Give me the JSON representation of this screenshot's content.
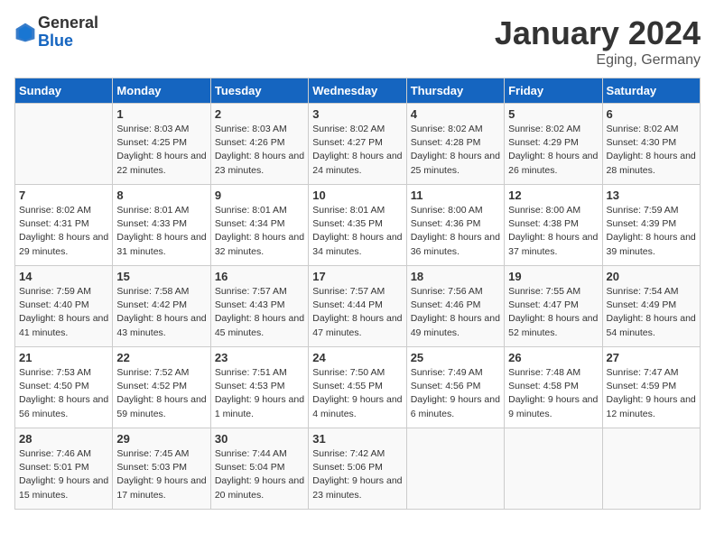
{
  "header": {
    "logo_general": "General",
    "logo_blue": "Blue",
    "title": "January 2024",
    "location": "Eging, Germany"
  },
  "days_of_week": [
    "Sunday",
    "Monday",
    "Tuesday",
    "Wednesday",
    "Thursday",
    "Friday",
    "Saturday"
  ],
  "weeks": [
    [
      {
        "day": "",
        "sunrise": "",
        "sunset": "",
        "daylight": ""
      },
      {
        "day": "1",
        "sunrise": "Sunrise: 8:03 AM",
        "sunset": "Sunset: 4:25 PM",
        "daylight": "Daylight: 8 hours and 22 minutes."
      },
      {
        "day": "2",
        "sunrise": "Sunrise: 8:03 AM",
        "sunset": "Sunset: 4:26 PM",
        "daylight": "Daylight: 8 hours and 23 minutes."
      },
      {
        "day": "3",
        "sunrise": "Sunrise: 8:02 AM",
        "sunset": "Sunset: 4:27 PM",
        "daylight": "Daylight: 8 hours and 24 minutes."
      },
      {
        "day": "4",
        "sunrise": "Sunrise: 8:02 AM",
        "sunset": "Sunset: 4:28 PM",
        "daylight": "Daylight: 8 hours and 25 minutes."
      },
      {
        "day": "5",
        "sunrise": "Sunrise: 8:02 AM",
        "sunset": "Sunset: 4:29 PM",
        "daylight": "Daylight: 8 hours and 26 minutes."
      },
      {
        "day": "6",
        "sunrise": "Sunrise: 8:02 AM",
        "sunset": "Sunset: 4:30 PM",
        "daylight": "Daylight: 8 hours and 28 minutes."
      }
    ],
    [
      {
        "day": "7",
        "sunrise": "Sunrise: 8:02 AM",
        "sunset": "Sunset: 4:31 PM",
        "daylight": "Daylight: 8 hours and 29 minutes."
      },
      {
        "day": "8",
        "sunrise": "Sunrise: 8:01 AM",
        "sunset": "Sunset: 4:33 PM",
        "daylight": "Daylight: 8 hours and 31 minutes."
      },
      {
        "day": "9",
        "sunrise": "Sunrise: 8:01 AM",
        "sunset": "Sunset: 4:34 PM",
        "daylight": "Daylight: 8 hours and 32 minutes."
      },
      {
        "day": "10",
        "sunrise": "Sunrise: 8:01 AM",
        "sunset": "Sunset: 4:35 PM",
        "daylight": "Daylight: 8 hours and 34 minutes."
      },
      {
        "day": "11",
        "sunrise": "Sunrise: 8:00 AM",
        "sunset": "Sunset: 4:36 PM",
        "daylight": "Daylight: 8 hours and 36 minutes."
      },
      {
        "day": "12",
        "sunrise": "Sunrise: 8:00 AM",
        "sunset": "Sunset: 4:38 PM",
        "daylight": "Daylight: 8 hours and 37 minutes."
      },
      {
        "day": "13",
        "sunrise": "Sunrise: 7:59 AM",
        "sunset": "Sunset: 4:39 PM",
        "daylight": "Daylight: 8 hours and 39 minutes."
      }
    ],
    [
      {
        "day": "14",
        "sunrise": "Sunrise: 7:59 AM",
        "sunset": "Sunset: 4:40 PM",
        "daylight": "Daylight: 8 hours and 41 minutes."
      },
      {
        "day": "15",
        "sunrise": "Sunrise: 7:58 AM",
        "sunset": "Sunset: 4:42 PM",
        "daylight": "Daylight: 8 hours and 43 minutes."
      },
      {
        "day": "16",
        "sunrise": "Sunrise: 7:57 AM",
        "sunset": "Sunset: 4:43 PM",
        "daylight": "Daylight: 8 hours and 45 minutes."
      },
      {
        "day": "17",
        "sunrise": "Sunrise: 7:57 AM",
        "sunset": "Sunset: 4:44 PM",
        "daylight": "Daylight: 8 hours and 47 minutes."
      },
      {
        "day": "18",
        "sunrise": "Sunrise: 7:56 AM",
        "sunset": "Sunset: 4:46 PM",
        "daylight": "Daylight: 8 hours and 49 minutes."
      },
      {
        "day": "19",
        "sunrise": "Sunrise: 7:55 AM",
        "sunset": "Sunset: 4:47 PM",
        "daylight": "Daylight: 8 hours and 52 minutes."
      },
      {
        "day": "20",
        "sunrise": "Sunrise: 7:54 AM",
        "sunset": "Sunset: 4:49 PM",
        "daylight": "Daylight: 8 hours and 54 minutes."
      }
    ],
    [
      {
        "day": "21",
        "sunrise": "Sunrise: 7:53 AM",
        "sunset": "Sunset: 4:50 PM",
        "daylight": "Daylight: 8 hours and 56 minutes."
      },
      {
        "day": "22",
        "sunrise": "Sunrise: 7:52 AM",
        "sunset": "Sunset: 4:52 PM",
        "daylight": "Daylight: 8 hours and 59 minutes."
      },
      {
        "day": "23",
        "sunrise": "Sunrise: 7:51 AM",
        "sunset": "Sunset: 4:53 PM",
        "daylight": "Daylight: 9 hours and 1 minute."
      },
      {
        "day": "24",
        "sunrise": "Sunrise: 7:50 AM",
        "sunset": "Sunset: 4:55 PM",
        "daylight": "Daylight: 9 hours and 4 minutes."
      },
      {
        "day": "25",
        "sunrise": "Sunrise: 7:49 AM",
        "sunset": "Sunset: 4:56 PM",
        "daylight": "Daylight: 9 hours and 6 minutes."
      },
      {
        "day": "26",
        "sunrise": "Sunrise: 7:48 AM",
        "sunset": "Sunset: 4:58 PM",
        "daylight": "Daylight: 9 hours and 9 minutes."
      },
      {
        "day": "27",
        "sunrise": "Sunrise: 7:47 AM",
        "sunset": "Sunset: 4:59 PM",
        "daylight": "Daylight: 9 hours and 12 minutes."
      }
    ],
    [
      {
        "day": "28",
        "sunrise": "Sunrise: 7:46 AM",
        "sunset": "Sunset: 5:01 PM",
        "daylight": "Daylight: 9 hours and 15 minutes."
      },
      {
        "day": "29",
        "sunrise": "Sunrise: 7:45 AM",
        "sunset": "Sunset: 5:03 PM",
        "daylight": "Daylight: 9 hours and 17 minutes."
      },
      {
        "day": "30",
        "sunrise": "Sunrise: 7:44 AM",
        "sunset": "Sunset: 5:04 PM",
        "daylight": "Daylight: 9 hours and 20 minutes."
      },
      {
        "day": "31",
        "sunrise": "Sunrise: 7:42 AM",
        "sunset": "Sunset: 5:06 PM",
        "daylight": "Daylight: 9 hours and 23 minutes."
      },
      {
        "day": "",
        "sunrise": "",
        "sunset": "",
        "daylight": ""
      },
      {
        "day": "",
        "sunrise": "",
        "sunset": "",
        "daylight": ""
      },
      {
        "day": "",
        "sunrise": "",
        "sunset": "",
        "daylight": ""
      }
    ]
  ]
}
